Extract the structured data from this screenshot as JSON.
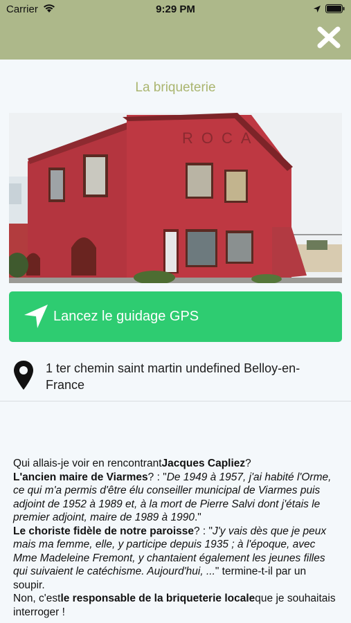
{
  "status_bar": {
    "carrier": "Carrier",
    "time": "9:29 PM"
  },
  "header": {
    "close_icon": "close-x-icon",
    "bg_color": "#adb88a"
  },
  "page": {
    "title": "La briqueterie"
  },
  "photo": {
    "sign_text": "ROCA"
  },
  "gps_button": {
    "label": "Lancez le guidage GPS",
    "icon": "navigation-arrow-icon",
    "color": "#2ecc71"
  },
  "address": {
    "icon": "map-pin-icon",
    "text": "1 ter chemin saint martin undefined Belloy-en-France"
  },
  "description": {
    "p1_a": "Qui allais-je voir en rencontrant",
    "p1_b": "Jacques Capliez",
    "p1_c": "?",
    "p2_a": "L'ancien maire de Viarmes",
    "p2_b": "? : \"",
    "p2_c": "De 1949 à 1957, j'ai habité l'Orme, ce qui m'a permis d'être élu conseiller municipal de Viarmes puis adjoint de 1952 à 1989 et, à la mort de Pierre Salvi dont j'étais le premier adjoint, maire de 1989 à 1990",
    "p2_d": ".\"",
    "p3_a": "Le choriste fidèle de notre paroisse",
    "p3_b": "? : \"",
    "p3_c": "J'y vais dès que je peux mais ma femme, elle, y participe depuis 1935 ; à l'époque, avec Mme Madeleine Fremont, y chantaient également les jeunes filles qui suivaient le catéchisme. Aujourd'hui, ...",
    "p3_d": "\" termine-t-il par un soupir.",
    "p4_a": "Non, c'est",
    "p4_b": "le responsable de la briqueterie locale",
    "p4_c": "que je souhaitais interroger !"
  }
}
